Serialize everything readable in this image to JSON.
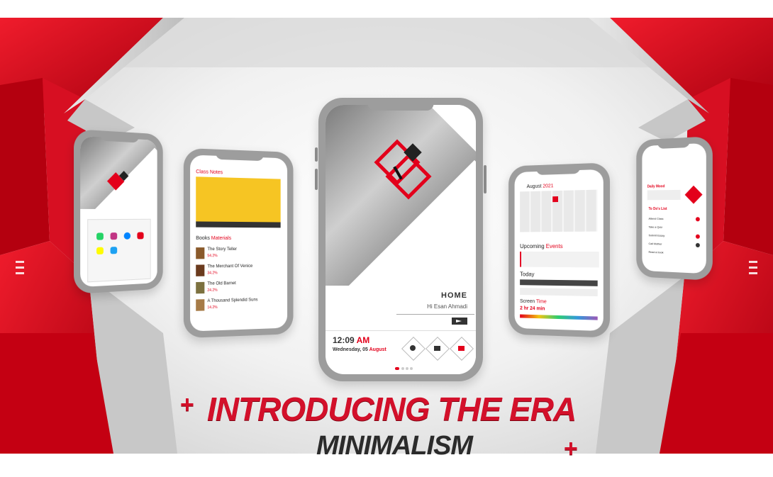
{
  "headline": {
    "plus_left": "+",
    "line1": "INTRODUCING THE ERA",
    "line2": "MINIMALISM",
    "plus_right": "+"
  },
  "center_phone": {
    "home_title": "HOME",
    "greeting": "Hi Esan Ahmadi",
    "time": "12:09",
    "ampm": "AM",
    "date_prefix": "Wednesday, 05",
    "date_month": "August"
  },
  "phone2": {
    "card_title": "Class Notes",
    "section_title": "Books",
    "section_title_red": "Materials",
    "books": [
      {
        "title": "The Story Teller",
        "meta": "54.2%"
      },
      {
        "title": "The Merchant Of Venice",
        "meta": "34.2%"
      },
      {
        "title": "The Old Barnet",
        "meta": "24.2%"
      },
      {
        "title": "A Thousand Splendid Suns",
        "meta": "14.2%"
      }
    ]
  },
  "phone4": {
    "month": "August",
    "year": "2021",
    "events_title": "Upcoming",
    "events_title_red": "Events",
    "today_label": "Today",
    "screen_label": "Screen",
    "screen_label_red": "Time",
    "screen_value": "2 hr 24 min"
  },
  "phone5": {
    "header": "Daily Mood",
    "section": "To Do's List",
    "items": [
      "Attend Class",
      "Take a Quiz",
      "Submit Essay",
      "Call Mother",
      "Read a book"
    ]
  },
  "colors": {
    "accent": "#e3001b",
    "dark": "#222222",
    "phone_frame": "#9d9d9d"
  }
}
